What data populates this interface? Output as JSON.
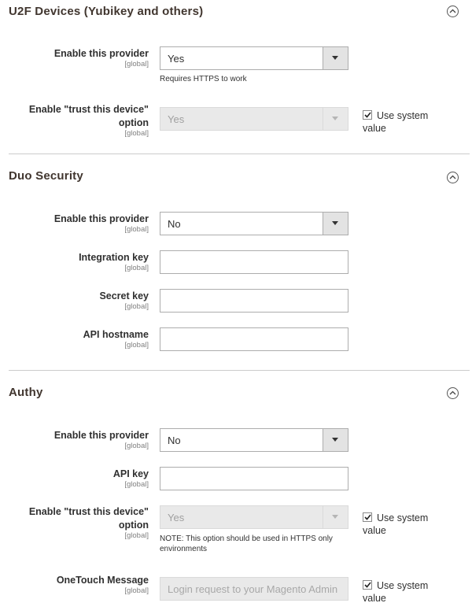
{
  "sections": [
    {
      "title": "U2F Devices (Yubikey and others)",
      "rows": {
        "enable_provider": {
          "label": "Enable this provider",
          "scope": "[global]",
          "value": "Yes",
          "note": "Requires HTTPS to work"
        },
        "trust_device": {
          "label_line1": "Enable \"trust this device\"",
          "label_line2": "option",
          "scope": "[global]",
          "value": "Yes",
          "use_system_value": "Use system value",
          "use_system_checked": true
        }
      }
    },
    {
      "title": "Duo Security",
      "rows": {
        "enable_provider": {
          "label": "Enable this provider",
          "scope": "[global]",
          "value": "No"
        },
        "integration_key": {
          "label": "Integration key",
          "scope": "[global]",
          "value": ""
        },
        "secret_key": {
          "label": "Secret key",
          "scope": "[global]",
          "value": ""
        },
        "api_hostname": {
          "label": "API hostname",
          "scope": "[global]",
          "value": ""
        }
      }
    },
    {
      "title": "Authy",
      "rows": {
        "enable_provider": {
          "label": "Enable this provider",
          "scope": "[global]",
          "value": "No"
        },
        "api_key": {
          "label": "API key",
          "scope": "[global]",
          "value": ""
        },
        "trust_device": {
          "label_line1": "Enable \"trust this device\"",
          "label_line2": "option",
          "scope": "[global]",
          "value": "Yes",
          "note": "NOTE: This option should be used in HTTPS only environments",
          "use_system_value": "Use system value",
          "use_system_checked": true
        },
        "onetouch_message": {
          "label": "OneTouch Message",
          "scope": "[global]",
          "value": "Login request to your Magento Admin",
          "use_system_value": "Use system value",
          "use_system_checked": true
        }
      }
    }
  ],
  "icons": {
    "collapse": "chevron-up-icon",
    "dropdown": "triangle-down-icon",
    "check": "checkmark-icon"
  },
  "colors": {
    "title": "#41362f",
    "border": "#adadad",
    "disabled_bg": "#e9e9e9",
    "divider": "#cccccc"
  }
}
